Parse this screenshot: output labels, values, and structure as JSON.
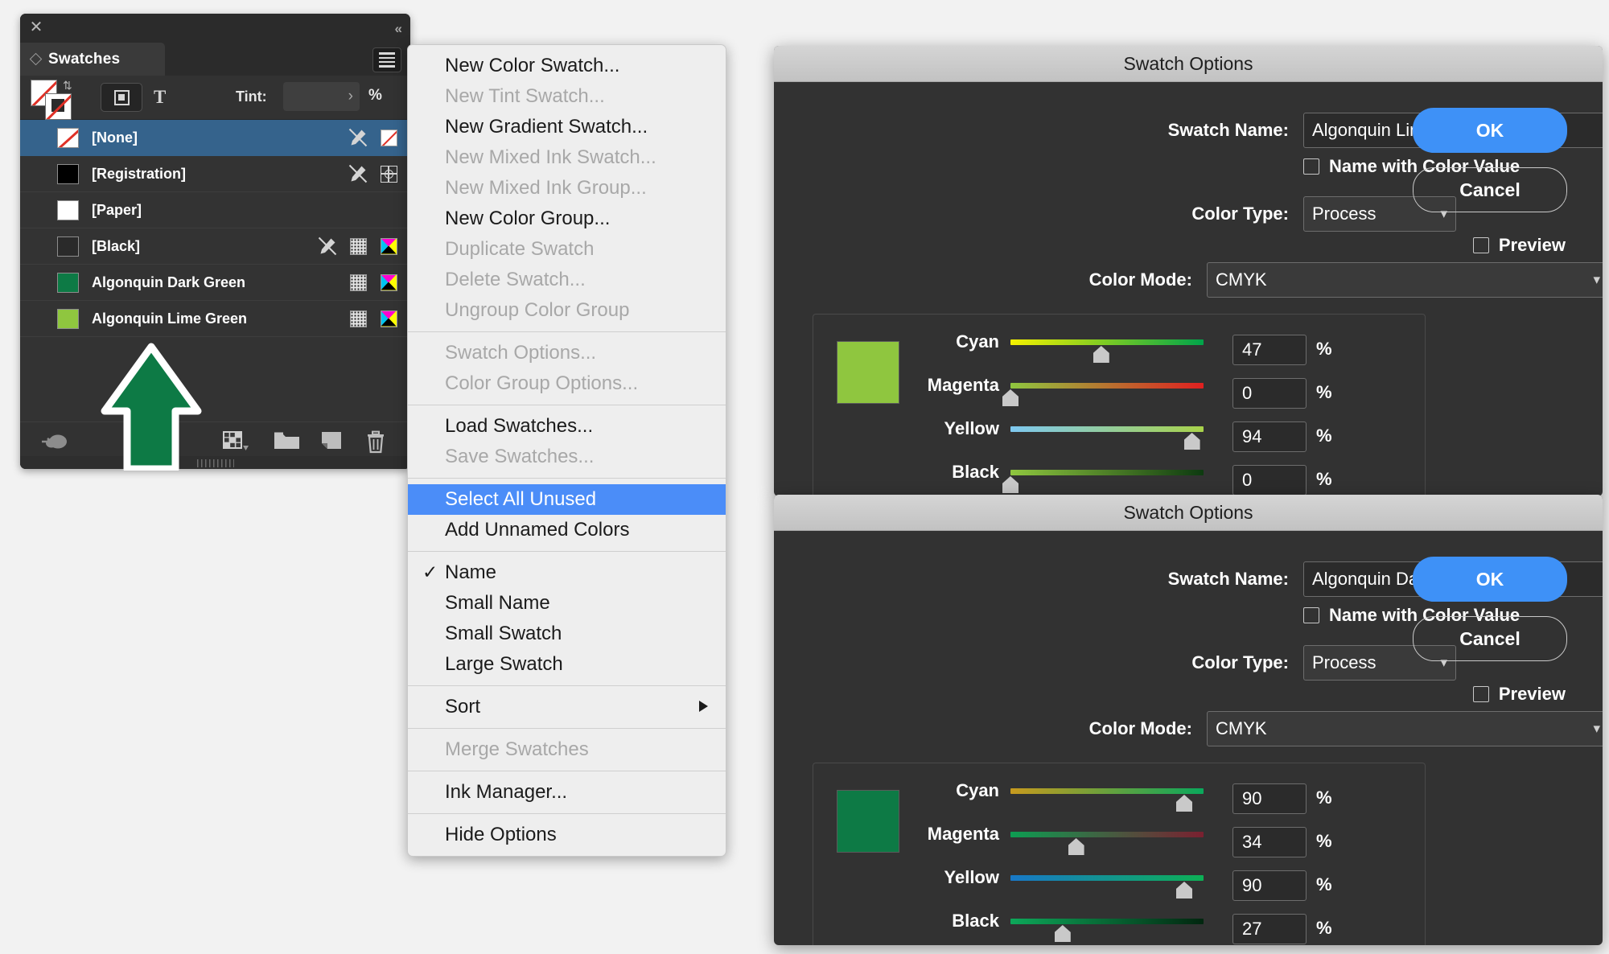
{
  "panel": {
    "title": "Swatches",
    "close_icon": "close-icon",
    "collapse_icon": "double-chevron-left-icon",
    "menu_icon": "hamburger-menu-icon",
    "controls": {
      "fill_stroke_icon": "fill-stroke-none-icon",
      "swap_icon": "swap-fill-stroke-icon",
      "container_icon": "formatting-affects-container-icon",
      "text_icon": "formatting-affects-text-icon",
      "tint_label": "Tint:",
      "tint_value": "",
      "tint_placeholder": "",
      "tint_unit": "%"
    },
    "columns_icons": [
      "no-edit-pen-icon",
      "halftone-tint-icon",
      "cmyk-process-icon"
    ],
    "swatches": [
      {
        "name": "[None]",
        "chip": "none",
        "chip_color": "#ffffff",
        "selected": true,
        "icons": [
          "no-edit-pen-icon",
          "none-swatch-icon"
        ]
      },
      {
        "name": "[Registration]",
        "chip": "solid",
        "chip_color": "#000000",
        "selected": false,
        "icons": [
          "no-edit-pen-icon",
          "registration-target-icon"
        ]
      },
      {
        "name": "[Paper]",
        "chip": "solid",
        "chip_color": "#ffffff",
        "selected": false,
        "icons": []
      },
      {
        "name": "[Black]",
        "chip": "solid",
        "chip_color": "#2a2a2a",
        "selected": false,
        "icons": [
          "no-edit-pen-icon",
          "halftone-tint-icon",
          "cmyk-process-icon"
        ]
      },
      {
        "name": "Algonquin Dark Green",
        "chip": "solid",
        "chip_color": "#0d7a45",
        "selected": false,
        "icons": [
          "halftone-tint-icon",
          "cmyk-process-icon"
        ]
      },
      {
        "name": "Algonquin Lime Green",
        "chip": "solid",
        "chip_color": "#8fc63f",
        "selected": false,
        "icons": [
          "halftone-tint-icon",
          "cmyk-process-icon"
        ]
      }
    ],
    "footer_buttons": [
      {
        "icon": "cc-libraries-icon",
        "name": "add-to-cc-library-button"
      },
      {
        "icon": "show-swatch-kinds-icon",
        "name": "show-swatch-kinds-button"
      },
      {
        "icon": "new-color-group-icon",
        "name": "new-color-group-button"
      },
      {
        "icon": "new-swatch-icon",
        "name": "new-swatch-button"
      },
      {
        "icon": "trash-icon",
        "name": "delete-swatch-button"
      }
    ]
  },
  "context_menu": {
    "groups": [
      [
        {
          "label": "New Color Swatch...",
          "state": "enabled"
        },
        {
          "label": "New Tint Swatch...",
          "state": "disabled"
        },
        {
          "label": "New Gradient Swatch...",
          "state": "enabled"
        },
        {
          "label": "New Mixed Ink Swatch...",
          "state": "disabled"
        },
        {
          "label": "New Mixed Ink Group...",
          "state": "disabled"
        },
        {
          "label": "New Color Group...",
          "state": "enabled"
        },
        {
          "label": "Duplicate Swatch",
          "state": "disabled"
        },
        {
          "label": "Delete Swatch...",
          "state": "disabled"
        },
        {
          "label": "Ungroup Color Group",
          "state": "disabled"
        }
      ],
      [
        {
          "label": "Swatch Options...",
          "state": "disabled"
        },
        {
          "label": "Color Group Options...",
          "state": "disabled"
        }
      ],
      [
        {
          "label": "Load Swatches...",
          "state": "enabled"
        },
        {
          "label": "Save Swatches...",
          "state": "disabled"
        }
      ],
      [
        {
          "label": "Select All Unused",
          "state": "highlighted"
        },
        {
          "label": "Add Unnamed Colors",
          "state": "enabled"
        }
      ],
      [
        {
          "label": "Name",
          "state": "enabled",
          "checked": true
        },
        {
          "label": "Small Name",
          "state": "enabled"
        },
        {
          "label": "Small Swatch",
          "state": "enabled"
        },
        {
          "label": "Large Swatch",
          "state": "enabled"
        }
      ],
      [
        {
          "label": "Sort",
          "state": "enabled",
          "submenu": true
        }
      ],
      [
        {
          "label": "Merge Swatches",
          "state": "disabled"
        }
      ],
      [
        {
          "label": "Ink Manager...",
          "state": "enabled"
        }
      ],
      [
        {
          "label": "Hide Options",
          "state": "enabled"
        }
      ]
    ],
    "checkmark_glyph": "✓",
    "submenu_glyph": "submenu-arrow-icon"
  },
  "dialogs": [
    {
      "title": "Swatch Options",
      "swatch_name_label": "Swatch Name:",
      "swatch_name_value": "Algonquin Lime Green",
      "name_with_color_value_label": "Name with Color Value",
      "name_with_color_value_checked": false,
      "color_type_label": "Color Type:",
      "color_type_value": "Process",
      "color_mode_label": "Color Mode:",
      "color_mode_value": "CMYK",
      "preview_label": "Preview",
      "preview_checked": false,
      "ok_label": "OK",
      "cancel_label": "Cancel",
      "swatch_preview_color": "#8fc63f",
      "unit": "%",
      "channels": [
        {
          "name": "Cyan",
          "value": 47,
          "track_from": "#f5f100",
          "track_to": "#00a34a"
        },
        {
          "name": "Magenta",
          "value": 0,
          "track_from": "#8fc63f",
          "track_to": "#e02020"
        },
        {
          "name": "Yellow",
          "value": 94,
          "track_from": "#7ec8f0",
          "track_to": "#a8d24a"
        },
        {
          "name": "Black",
          "value": 0,
          "track_from": "#8fc63f",
          "track_to": "#0d3a10"
        }
      ]
    },
    {
      "title": "Swatch Options",
      "swatch_name_label": "Swatch Name:",
      "swatch_name_value": "Algonquin Dark Green",
      "name_with_color_value_label": "Name with Color Value",
      "name_with_color_value_checked": false,
      "color_type_label": "Color Type:",
      "color_type_value": "Process",
      "color_mode_label": "Color Mode:",
      "color_mode_value": "CMYK",
      "preview_label": "Preview",
      "preview_checked": false,
      "ok_label": "OK",
      "cancel_label": "Cancel",
      "swatch_preview_color": "#0d7a45",
      "unit": "%",
      "channels": [
        {
          "name": "Cyan",
          "value": 90,
          "track_from": "#c79a1e",
          "track_to": "#0aa85c"
        },
        {
          "name": "Magenta",
          "value": 34,
          "track_from": "#0d9d52",
          "track_to": "#7a2030"
        },
        {
          "name": "Yellow",
          "value": 90,
          "track_from": "#1878c8",
          "track_to": "#0db055"
        },
        {
          "name": "Black",
          "value": 27,
          "track_from": "#0da85a",
          "track_to": "#02260f"
        }
      ]
    }
  ],
  "annotation": {
    "arrow_icon": "green-up-arrow-annotation",
    "arrow_color": "#0d7a45"
  }
}
